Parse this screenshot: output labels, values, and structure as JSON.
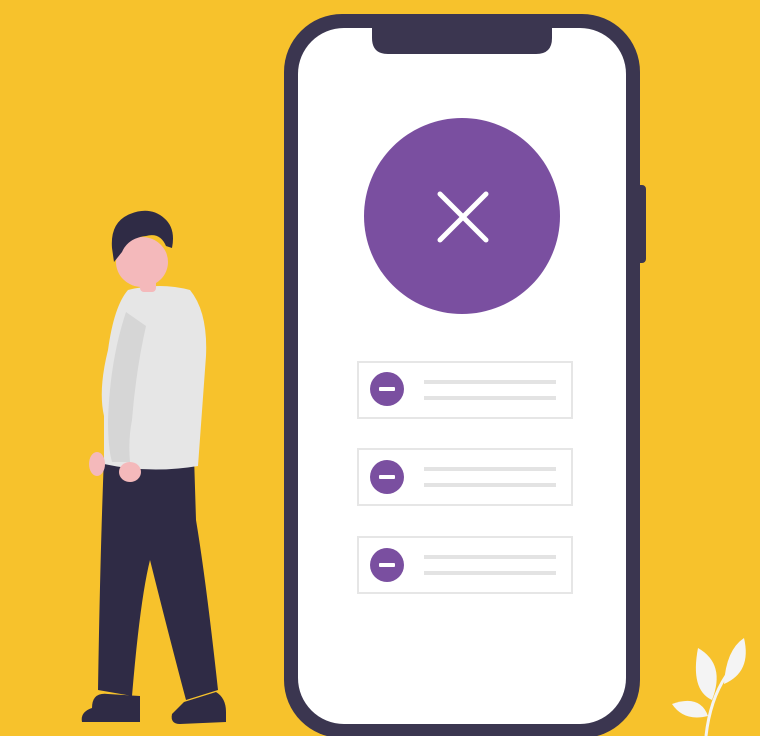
{
  "scene": {
    "background_color": "#f7c22c",
    "accent_color": "#7a4fa0",
    "phone_frame_color": "#3b3650",
    "phone_screen_color": "#ffffff",
    "error_icon": "close-icon",
    "list_items": [
      {
        "icon": "minus-circle-icon"
      },
      {
        "icon": "minus-circle-icon"
      },
      {
        "icon": "minus-circle-icon"
      }
    ]
  }
}
